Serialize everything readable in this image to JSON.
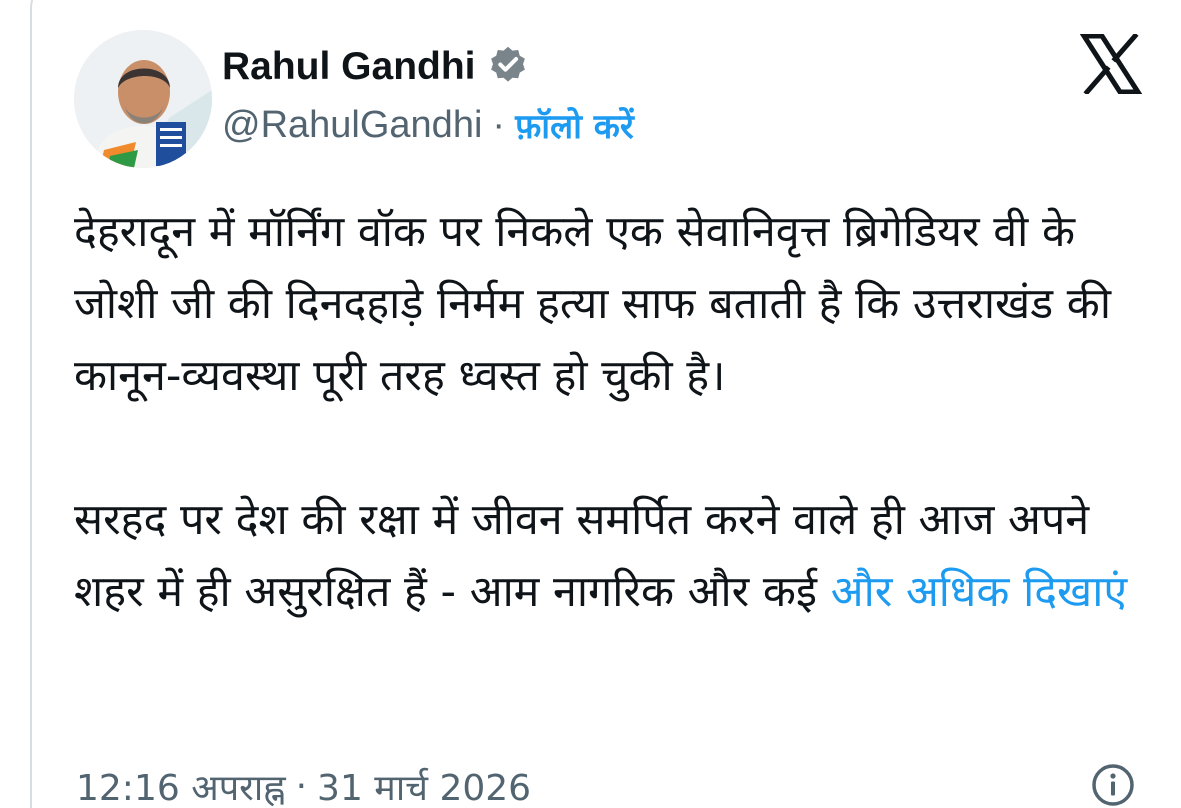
{
  "tweet": {
    "author_name": "Rahul Gandhi",
    "author_handle": "@RahulGandhi",
    "separator": "·",
    "follow_label": "फ़ॉलो करें",
    "paragraph_1": "देहरादून में मॉर्निंग वॉक पर निकले एक सेवानिवृत्त ब्रिगेडियर वी के जोशी जी की दिनदहाड़े निर्मम हत्या साफ बताती है कि उत्तराखंड की कानून-व्यवस्था पूरी तरह ध्वस्त हो चुकी है।",
    "paragraph_2": "सरहद पर देश की रक्षा में जीवन समर्पित करने वाले ही आज अपने शहर में ही असुरक्षित हैं - आम नागरिक और कई",
    "show_more_label": "और अधिक दिखाएं",
    "time": "12:16 अपराह्न",
    "date": "31 मार्च 2026"
  },
  "icons": {
    "avatar": "avatar",
    "verified": "verified-badge-icon",
    "logo": "x-logo-icon",
    "info": "info-icon"
  },
  "colors": {
    "accent": "#1d9bf0",
    "text": "#0f1419",
    "secondary": "#536471",
    "border": "#d7dee3"
  }
}
